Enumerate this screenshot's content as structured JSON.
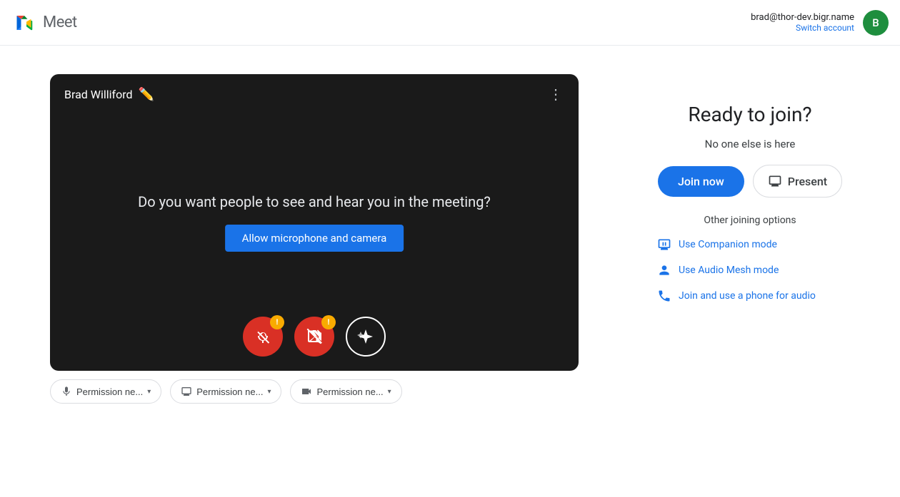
{
  "header": {
    "app_name": "Meet",
    "account_email": "brad@thor-dev.bigr.name",
    "switch_account_label": "Switch account",
    "avatar_letter": "B",
    "avatar_color": "#1e8e3e"
  },
  "video": {
    "user_name": "Brad Williford",
    "question_text": "Do you want people to see and hear you in the meeting?",
    "allow_btn_label": "Allow microphone and camera"
  },
  "permissions": {
    "mic_label": "Permission ne...",
    "screen_label": "Permission ne...",
    "camera_label": "Permission ne..."
  },
  "join_panel": {
    "ready_title": "Ready to join?",
    "no_one_text": "No one else is here",
    "join_now_label": "Join now",
    "present_label": "Present",
    "other_options_title": "Other joining options",
    "companion_mode_label": "Use Companion mode",
    "audio_mesh_label": "Use Audio Mesh mode",
    "phone_audio_label": "Join and use a phone for audio"
  }
}
